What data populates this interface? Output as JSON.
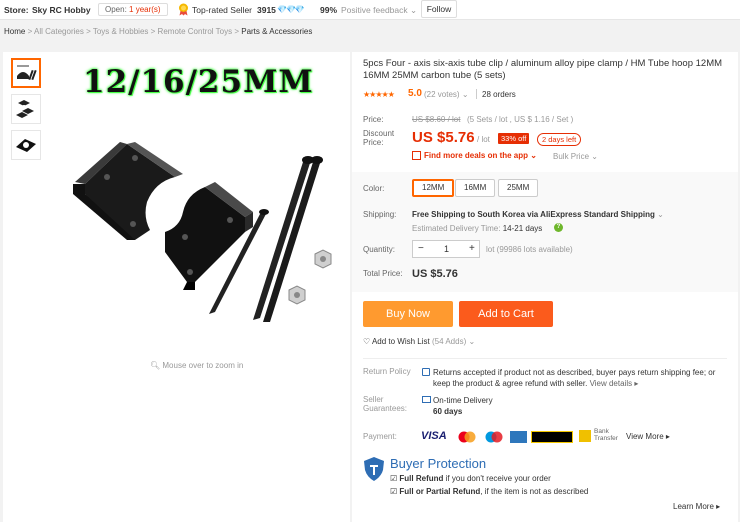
{
  "store": {
    "label": "Store:",
    "name": "Sky RC Hobby",
    "open_prefix": "Open:",
    "open_years": "1 year(s)",
    "top_rated": "Top-rated Seller",
    "score": "3915",
    "diamonds": "💎💎💎",
    "feedback_pct": "99%",
    "feedback_label": "Positive feedback",
    "follow": "Follow"
  },
  "breadcrumb": {
    "home": "Home",
    "items": [
      "All Categories",
      "Toys & Hobbies",
      "Remote Control Toys",
      "Parts & Accessories"
    ]
  },
  "gallery": {
    "overlay_title": "12/16/25MM",
    "zoom_hint": "Mouse over to zoom in"
  },
  "product": {
    "title": "5pcs Four - axis six-axis tube clip / aluminum alloy pipe clamp / HM Tube hoop 12MM 16MM 25MM carbon tube (5 sets)",
    "stars": "★★★★★",
    "rating": "5.0",
    "votes": "(22 votes)",
    "orders": "28 orders"
  },
  "price": {
    "price_label": "Price:",
    "old_price": "US $8.60 / lot",
    "old_unit": "(5 Sets / lot , US $ 1.16 / Set )",
    "discount_label": "Discount Price:",
    "discount_price": "US $5.76",
    "discount_unit": "/ lot",
    "off": "33% off",
    "days_left": "2 days left",
    "deals": "Find more deals on the app",
    "bulk": "Bulk Price"
  },
  "options": {
    "color_label": "Color:",
    "colors": [
      "12MM",
      "16MM",
      "25MM"
    ],
    "selected_color": "12MM",
    "shipping_label": "Shipping:",
    "shipping_text": "Free Shipping to South Korea via AliExpress Standard Shipping",
    "eta_label": "Estimated Delivery Time:",
    "eta_value": "14-21",
    "eta_unit": "days",
    "quantity_label": "Quantity:",
    "quantity": "1",
    "minus": "−",
    "plus": "+",
    "quantity_unit": "lot (99986 lots available)",
    "total_label": "Total Price:",
    "total_price": "US $5.76"
  },
  "actions": {
    "buy_now": "Buy Now",
    "add_to_cart": "Add to Cart",
    "wish": "Add to Wish List",
    "wish_count": "(54 Adds)"
  },
  "policy": {
    "return_label": "Return Policy",
    "return_text": "Returns accepted if product not as described, buyer pays return shipping fee; or keep the product & agree refund with seller.",
    "view_details": "View details",
    "seller_label": "Seller Guarantees:",
    "on_time": "On-time Delivery",
    "days": "60 days",
    "payment_label": "Payment:",
    "visa": "VISA",
    "bank_transfer": "Bank Transfer",
    "view_more": "View More"
  },
  "buyer_protection": {
    "title": "Buyer Protection",
    "full_refund": "Full Refund",
    "full_refund_text": "if you don't receive your order",
    "partial": "Full or Partial Refund",
    "partial_text": ", if the item is not as described",
    "learn_more": "Learn More"
  },
  "colors": {
    "accent": "#e62e04",
    "buy_now": "#ff9a2f",
    "add_to_cart": "#fb5b1c",
    "protection": "#2e6db4"
  }
}
